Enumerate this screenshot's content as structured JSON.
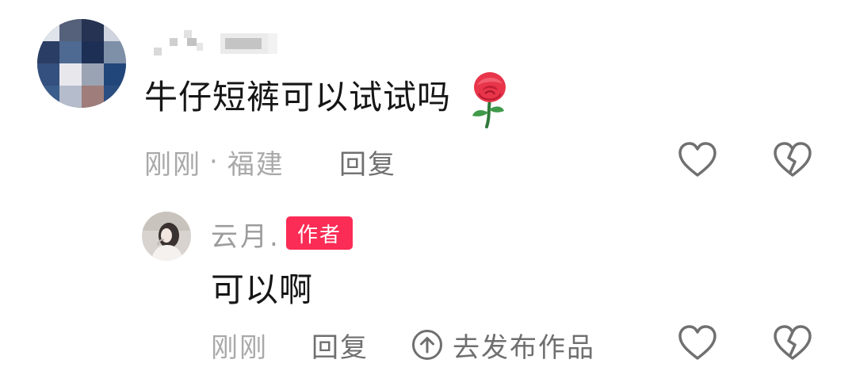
{
  "comment": {
    "avatar_icon": "pixelated-avatar",
    "username_icon": "pixelated-username",
    "text": "牛仔短裤可以试试吗",
    "emoji_icon": "rose-icon",
    "time": "刚刚",
    "separator": "·",
    "location": "福建",
    "reply_label": "回复",
    "like_icon": "heart-icon",
    "dislike_icon": "broken-heart-icon"
  },
  "reply": {
    "avatar_icon": "user-avatar",
    "username": "云月.",
    "badge": "作者",
    "text": "可以啊",
    "time": "刚刚",
    "reply_label": "回复",
    "publish_icon": "arrow-up-circle-icon",
    "publish_label": "去发布作品",
    "like_icon": "heart-icon",
    "dislike_icon": "broken-heart-icon"
  },
  "colors": {
    "badge": "#fb2c55",
    "text_primary": "#161616",
    "text_muted": "#a9a9a9",
    "text_action": "#6f6f6f",
    "icon_stroke": "#707070"
  }
}
